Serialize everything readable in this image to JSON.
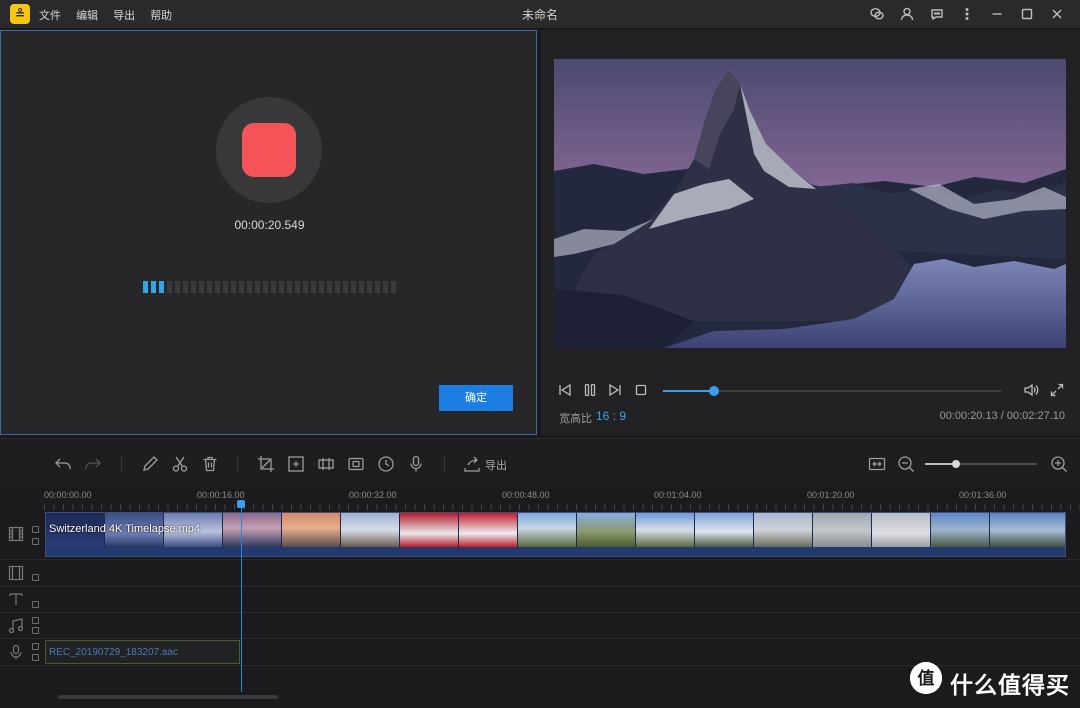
{
  "app": {
    "title": "未命名",
    "logo_glyph": "≗"
  },
  "menu": {
    "items": [
      "文件",
      "编辑",
      "导出",
      "帮助"
    ]
  },
  "title_icons": [
    "wechat-icon",
    "user-icon",
    "feedback-icon",
    "more-icon",
    "minimize-icon",
    "maximize-icon",
    "close-icon"
  ],
  "recorder": {
    "time": "00:00:20.549",
    "confirm_label": "确定",
    "level_total": 32,
    "level_active": 3,
    "record_color": "#f45458"
  },
  "player": {
    "aspect_label": "宽高比",
    "aspect_value": "16 : 9",
    "time_readout": "00:00:20.13 / 00:02:27.10",
    "progress": 0.15,
    "accent": "#3aa0ee"
  },
  "toolbar": {
    "export_label": "导出",
    "zoom_level": 0.28
  },
  "timeline": {
    "ruler_labels": [
      "00:00:00.00",
      "00:00:16.00",
      "00:00:32.00",
      "00:00:48.00",
      "00:01:04.00",
      "00:01:20.00",
      "00:01:36.00"
    ],
    "video_clip_name": "Switzerland 4K  Timelapse.mp4",
    "audio_clip_name": "REC_20190729_183207.aac"
  },
  "watermark": {
    "logo_glyph": "值",
    "text": "什么值得买"
  }
}
